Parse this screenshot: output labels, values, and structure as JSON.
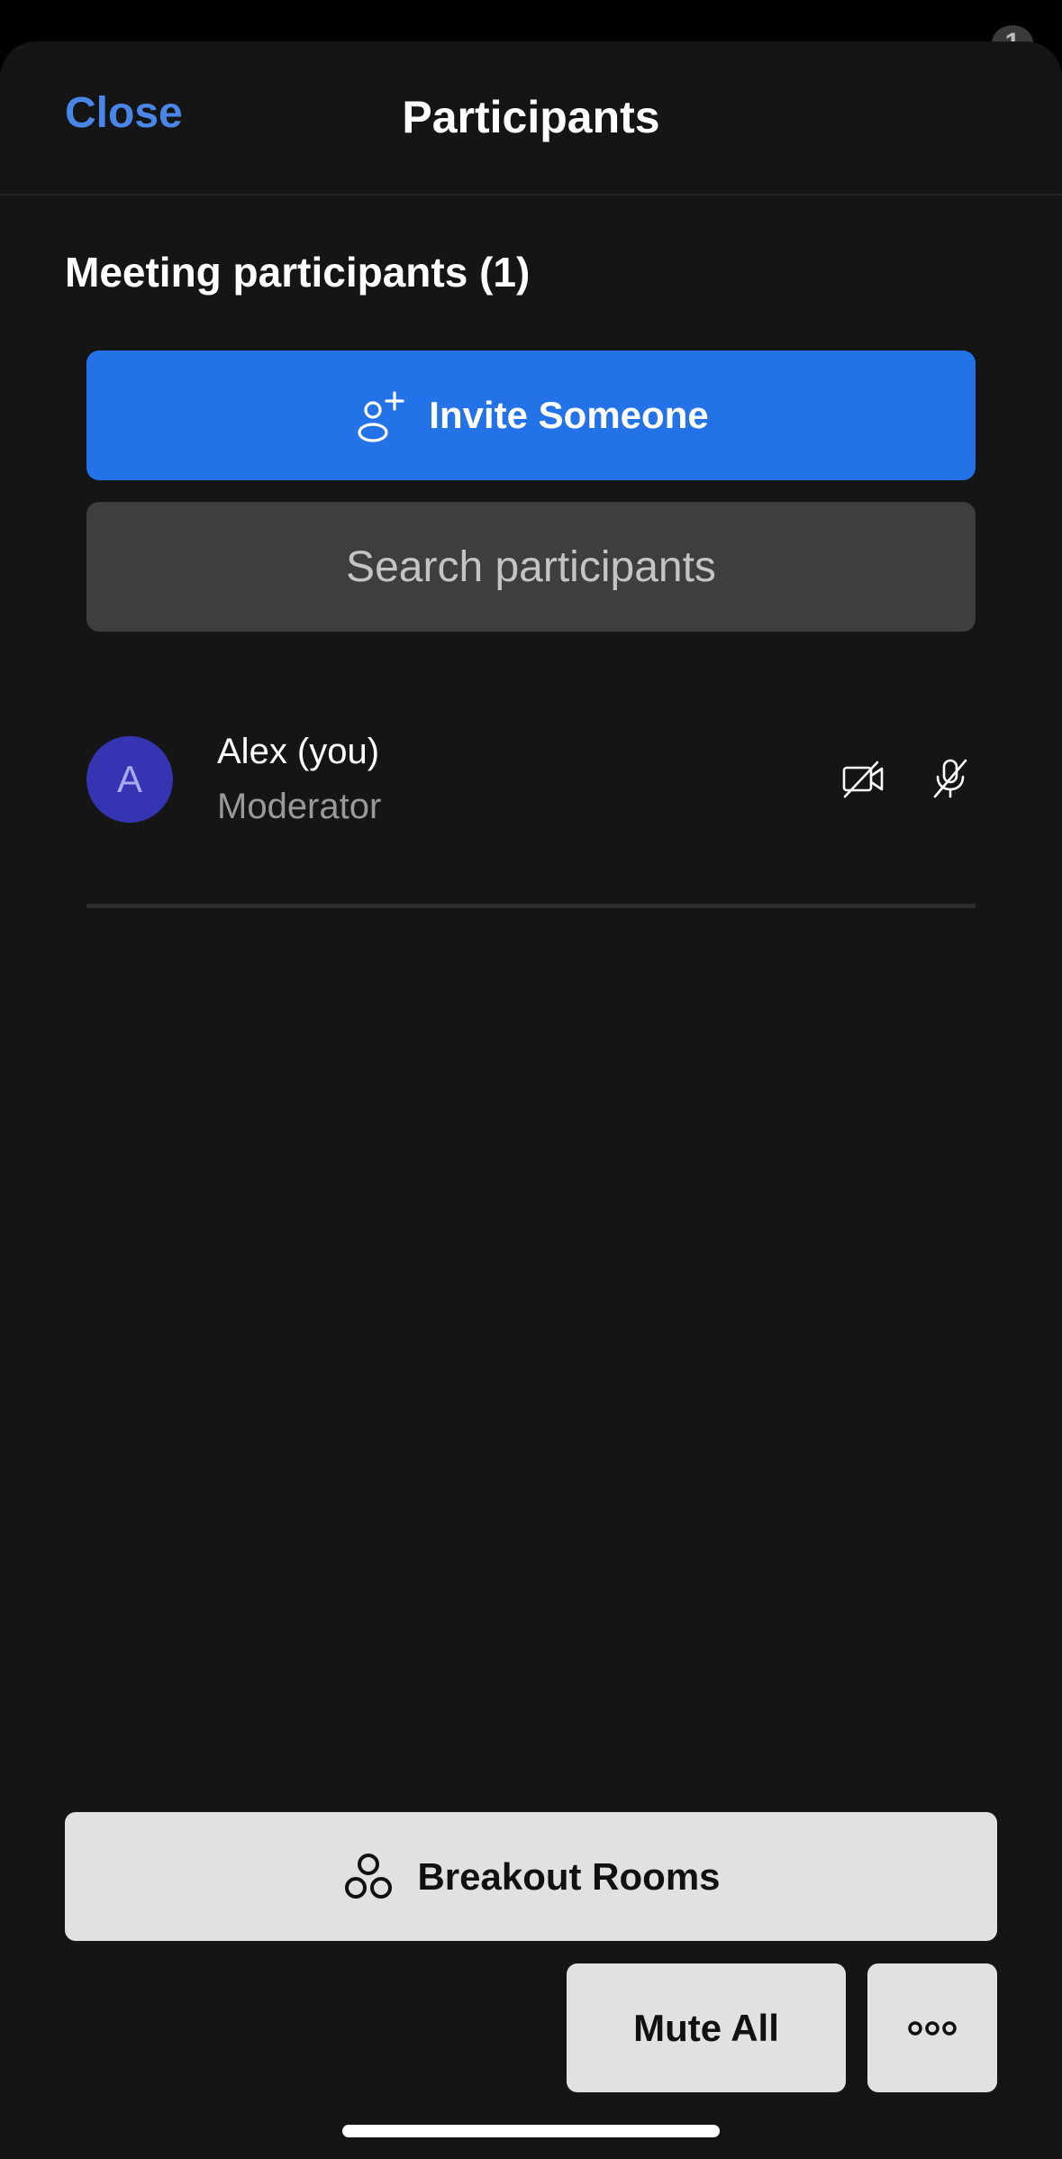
{
  "status": {
    "badge": "1"
  },
  "header": {
    "close_label": "Close",
    "title": "Participants"
  },
  "section": {
    "title": "Meeting participants (1)"
  },
  "invite": {
    "label": "Invite Someone",
    "icon": "add-person-icon"
  },
  "search": {
    "placeholder": "Search participants",
    "value": ""
  },
  "participants": [
    {
      "initial": "A",
      "name": "Alex (you)",
      "role": "Moderator",
      "video": "camera-off-icon",
      "audio": "mic-off-icon"
    }
  ],
  "footer": {
    "breakout_label": "Breakout Rooms",
    "breakout_icon": "breakout-rooms-icon",
    "mute_all_label": "Mute All",
    "more_icon": "more-options-icon"
  },
  "colors": {
    "accent": "#2472e8",
    "link": "#4a86e8",
    "avatar": "#3535b4",
    "background": "#151515"
  }
}
